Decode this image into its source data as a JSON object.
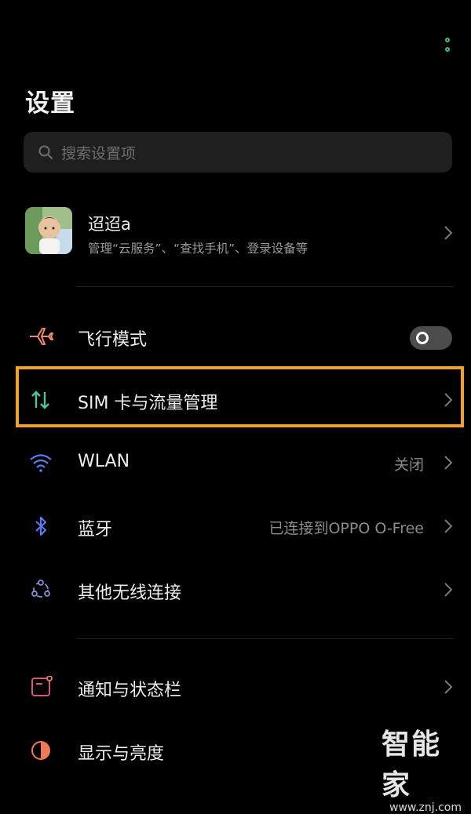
{
  "header": {
    "title": "设置",
    "more_icon": "more-vertical-icon",
    "accent": "#38c27a"
  },
  "search": {
    "placeholder": "搜索设置项"
  },
  "account": {
    "name": "迢迢a",
    "subtitle": "管理“云服务”、“查找手机”、登录设备等"
  },
  "settings": {
    "items": [
      {
        "label": "飞行模式",
        "icon": "airplane-icon",
        "icon_color": "#f08a6a",
        "toggle_on": false
      },
      {
        "label": "SIM 卡与流量管理",
        "icon": "data-transfer-icon",
        "icon_color": "#4fc3a1",
        "highlighted": true
      },
      {
        "label": "WLAN",
        "value": "关闭",
        "icon": "wifi-icon",
        "icon_color": "#5b7cf0"
      },
      {
        "label": "蓝牙",
        "value": "已连接到OPPO O-Free",
        "icon": "bluetooth-icon",
        "icon_color": "#5b7cf0"
      },
      {
        "label": "其他无线连接",
        "icon": "network-nodes-icon",
        "icon_color": "#7b8fd8"
      },
      {
        "label": "通知与状态栏",
        "icon": "notification-icon",
        "icon_color": "#d15a6e"
      },
      {
        "label": "显示与亮度",
        "icon": "brightness-icon",
        "icon_color": "#f07a55"
      }
    ]
  },
  "highlight_color": "#f2a323",
  "watermark": {
    "logo": "智能家",
    "url": "www.znj.com"
  }
}
